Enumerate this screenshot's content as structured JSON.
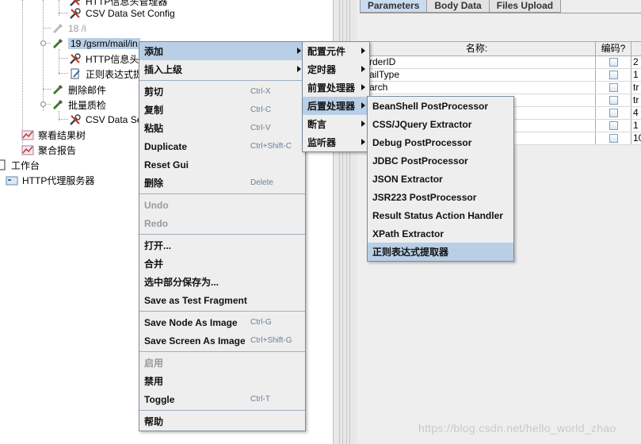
{
  "tree": {
    "items": [
      {
        "label": "HTTP信息头管理器",
        "icon": "wrench-icon",
        "state": "normal"
      },
      {
        "label": "CSV Data Set Config",
        "icon": "wrench-icon",
        "state": "normal"
      },
      {
        "label": "18 /i",
        "icon": "pipette-icon",
        "state": "disabled"
      },
      {
        "label": "19 /gsrm/mail/in",
        "icon": "pipette-icon",
        "state": "selected"
      },
      {
        "label": "HTTP信息头",
        "icon": "wrench-icon",
        "state": "normal"
      },
      {
        "label": "正则表达式提",
        "icon": "extractor-icon",
        "state": "normal"
      },
      {
        "label": "删除邮件",
        "icon": "pipette-icon",
        "state": "normal"
      },
      {
        "label": "批量质检",
        "icon": "pipette-icon",
        "state": "normal"
      },
      {
        "label": "CSV Data Se",
        "icon": "wrench-icon",
        "state": "normal"
      },
      {
        "label": "察看结果树",
        "icon": "chart-icon",
        "state": "normal"
      },
      {
        "label": "聚合报告",
        "icon": "chart-icon",
        "state": "normal"
      },
      {
        "label": "工作台",
        "icon": "workbench-icon",
        "state": "normal"
      },
      {
        "label": "HTTP代理服务器",
        "icon": "proxy-icon",
        "state": "normal"
      }
    ]
  },
  "tabs": [
    "Parameters",
    "Body Data",
    "Files Upload"
  ],
  "params_table": {
    "headers": {
      "name": "名称:",
      "encode": "编码?"
    },
    "rows": [
      {
        "name": "rderID",
        "value": "2"
      },
      {
        "name": "ailType",
        "value": "1"
      },
      {
        "name": "arch",
        "value": "tr"
      },
      {
        "name": "",
        "value": "tr"
      },
      {
        "name": "",
        "value": "4"
      },
      {
        "name": "",
        "value": "1"
      },
      {
        "name": "",
        "value": "10"
      }
    ]
  },
  "context_menu": {
    "groups": [
      [
        {
          "label": "添加",
          "shortcut": "",
          "submenu": true,
          "enabled": true,
          "highlight": true
        },
        {
          "label": "插入上级",
          "shortcut": "",
          "submenu": true,
          "enabled": true,
          "highlight": false
        }
      ],
      [
        {
          "label": "剪切",
          "shortcut": "Ctrl-X",
          "enabled": true
        },
        {
          "label": "复制",
          "shortcut": "Ctrl-C",
          "enabled": true
        },
        {
          "label": "粘贴",
          "shortcut": "Ctrl-V",
          "enabled": true
        },
        {
          "label": "Duplicate",
          "shortcut": "Ctrl+Shift-C",
          "enabled": true
        },
        {
          "label": "Reset Gui",
          "shortcut": "",
          "enabled": true
        },
        {
          "label": "删除",
          "shortcut": "Delete",
          "enabled": true
        }
      ],
      [
        {
          "label": "Undo",
          "shortcut": "",
          "enabled": false
        },
        {
          "label": "Redo",
          "shortcut": "",
          "enabled": false
        }
      ],
      [
        {
          "label": "打开...",
          "shortcut": "",
          "enabled": true
        },
        {
          "label": "合并",
          "shortcut": "",
          "enabled": true
        },
        {
          "label": "选中部分保存为...",
          "shortcut": "",
          "enabled": true
        },
        {
          "label": "Save as Test Fragment",
          "shortcut": "",
          "enabled": true
        }
      ],
      [
        {
          "label": "Save Node As Image",
          "shortcut": "Ctrl-G",
          "enabled": true
        },
        {
          "label": "Save Screen As Image",
          "shortcut": "Ctrl+Shift-G",
          "enabled": true
        }
      ],
      [
        {
          "label": "启用",
          "shortcut": "",
          "enabled": false
        },
        {
          "label": "禁用",
          "shortcut": "",
          "enabled": true
        },
        {
          "label": "Toggle",
          "shortcut": "Ctrl-T",
          "enabled": true
        }
      ],
      [
        {
          "label": "帮助",
          "shortcut": "",
          "enabled": true
        }
      ]
    ]
  },
  "add_submenu": {
    "items": [
      {
        "label": "配置元件",
        "highlight": false
      },
      {
        "label": "定时器",
        "highlight": false
      },
      {
        "label": "前置处理器",
        "highlight": false
      },
      {
        "label": "后置处理器",
        "highlight": true
      },
      {
        "label": "断言",
        "highlight": false
      },
      {
        "label": "监听器",
        "highlight": false
      }
    ]
  },
  "post_processor_submenu": {
    "items": [
      {
        "label": "BeanShell PostProcessor",
        "highlight": false
      },
      {
        "label": "CSS/JQuery Extractor",
        "highlight": false
      },
      {
        "label": "Debug PostProcessor",
        "highlight": false
      },
      {
        "label": "JDBC PostProcessor",
        "highlight": false
      },
      {
        "label": "JSON Extractor",
        "highlight": false
      },
      {
        "label": "JSR223 PostProcessor",
        "highlight": false
      },
      {
        "label": "Result Status Action Handler",
        "highlight": false
      },
      {
        "label": "XPath Extractor",
        "highlight": false
      },
      {
        "label": "正则表达式提取器",
        "highlight": true
      }
    ]
  },
  "watermark": "https://blog.csdn.net/hello_world_zhao",
  "colors": {
    "selection": "#b8cfe5",
    "panel": "#eeeeee",
    "menu_border": "#7a8a99"
  }
}
